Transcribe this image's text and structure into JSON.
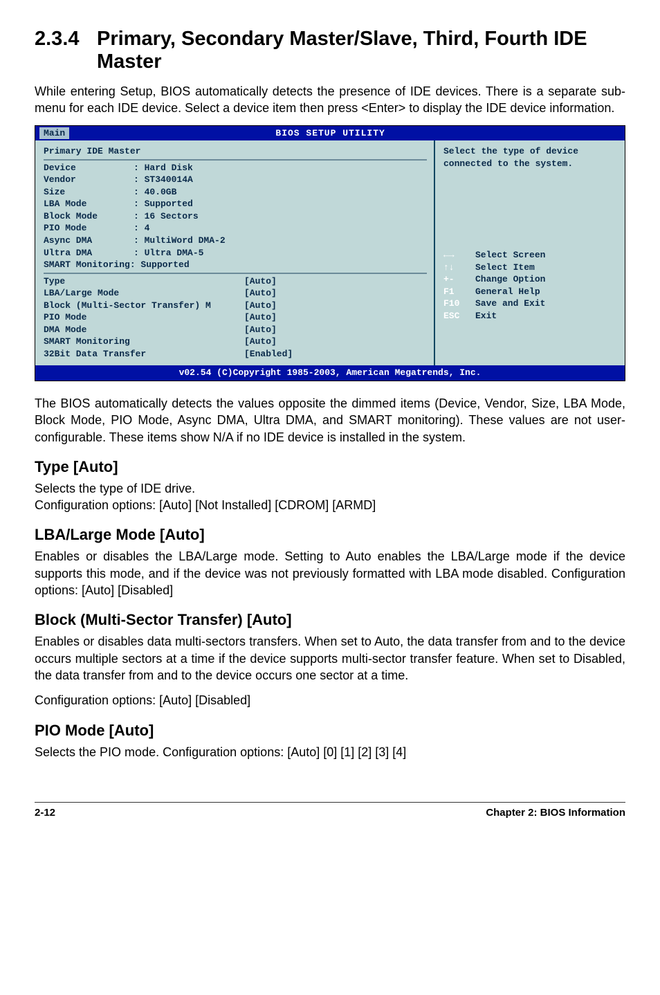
{
  "section": {
    "number": "2.3.4",
    "title": "Primary, Secondary Master/Slave, Third, Fourth IDE Master"
  },
  "intro": "While entering Setup, BIOS automatically detects the presence of IDE devices. There is a separate sub-menu for each IDE device. Select a device item then press <Enter> to display the IDE device information.",
  "bios": {
    "activeTab": "Main",
    "titleBar": "BIOS SETUP UTILITY",
    "screenTitle": "Primary IDE Master",
    "info": [
      {
        "label": "Device",
        "value": ": Hard Disk"
      },
      {
        "label": "Vendor",
        "value": ": ST340014A"
      },
      {
        "label": "Size",
        "value": ": 40.0GB"
      },
      {
        "label": "LBA Mode",
        "value": ": Supported"
      },
      {
        "label": "Block Mode",
        "value": ": 16 Sectors"
      },
      {
        "label": "PIO Mode",
        "value": ": 4"
      },
      {
        "label": "Async DMA",
        "value": ": MultiWord DMA-2"
      },
      {
        "label": "Ultra DMA",
        "value": ": Ultra DMA-5"
      },
      {
        "label": "SMART Monitoring: Supported",
        "value": ""
      }
    ],
    "options": [
      {
        "label": "Type",
        "value": "[Auto]"
      },
      {
        "label": "LBA/Large Mode",
        "value": "[Auto]"
      },
      {
        "label": "Block (Multi-Sector Transfer) M",
        "value": "[Auto]"
      },
      {
        "label": "PIO Mode",
        "value": "[Auto]"
      },
      {
        "label": "DMA Mode",
        "value": "[Auto]"
      },
      {
        "label": "SMART Monitoring",
        "value": "[Auto]"
      },
      {
        "label": "32Bit Data Transfer",
        "value": "[Enabled]"
      }
    ],
    "help": "Select the type of device connected to the system.",
    "keys": [
      {
        "key": "←→",
        "text": "Select Screen"
      },
      {
        "key": "↑↓",
        "text": "Select Item"
      },
      {
        "key": "+-",
        "text": "Change Option"
      },
      {
        "key": "F1",
        "text": "General Help"
      },
      {
        "key": "F10",
        "text": "Save and Exit"
      },
      {
        "key": "ESC",
        "text": "Exit"
      }
    ],
    "footer": "v02.54 (C)Copyright 1985-2003, American Megatrends, Inc."
  },
  "afterBios": "The BIOS automatically detects the values opposite the dimmed items (Device, Vendor, Size, LBA Mode, Block Mode, PIO Mode, Async DMA, Ultra DMA, and SMART monitoring). These values are not user-configurable. These items show N/A if no IDE device is installed in the system.",
  "typeSection": {
    "heading": "Type [Auto]",
    "line1": "Selects the type of IDE drive.",
    "line2": "Configuration options: [Auto] [Not Installed] [CDROM] [ARMD]"
  },
  "lbaSection": {
    "heading": "LBA/Large Mode [Auto]",
    "text": "Enables or disables the LBA/Large mode. Setting to Auto enables the LBA/Large mode if the device supports this mode, and if the device was not previously formatted with LBA mode disabled. Configuration options: [Auto] [Disabled]"
  },
  "blockSection": {
    "heading": "Block (Multi-Sector Transfer) [Auto]",
    "text": "Enables or disables data multi-sectors transfers. When set to Auto, the data transfer from and to the device occurs multiple sectors at a time if the device supports multi-sector transfer feature. When set to Disabled, the data transfer from and to the device occurs one sector at a time.",
    "text2": " Configuration options: [Auto] [Disabled]"
  },
  "pioSection": {
    "heading": "PIO Mode [Auto]",
    "text": "Selects the PIO mode. Configuration options: [Auto] [0] [1] [2] [3] [4]"
  },
  "footer": {
    "page": "2-12",
    "chapter": "Chapter 2: BIOS Information"
  }
}
